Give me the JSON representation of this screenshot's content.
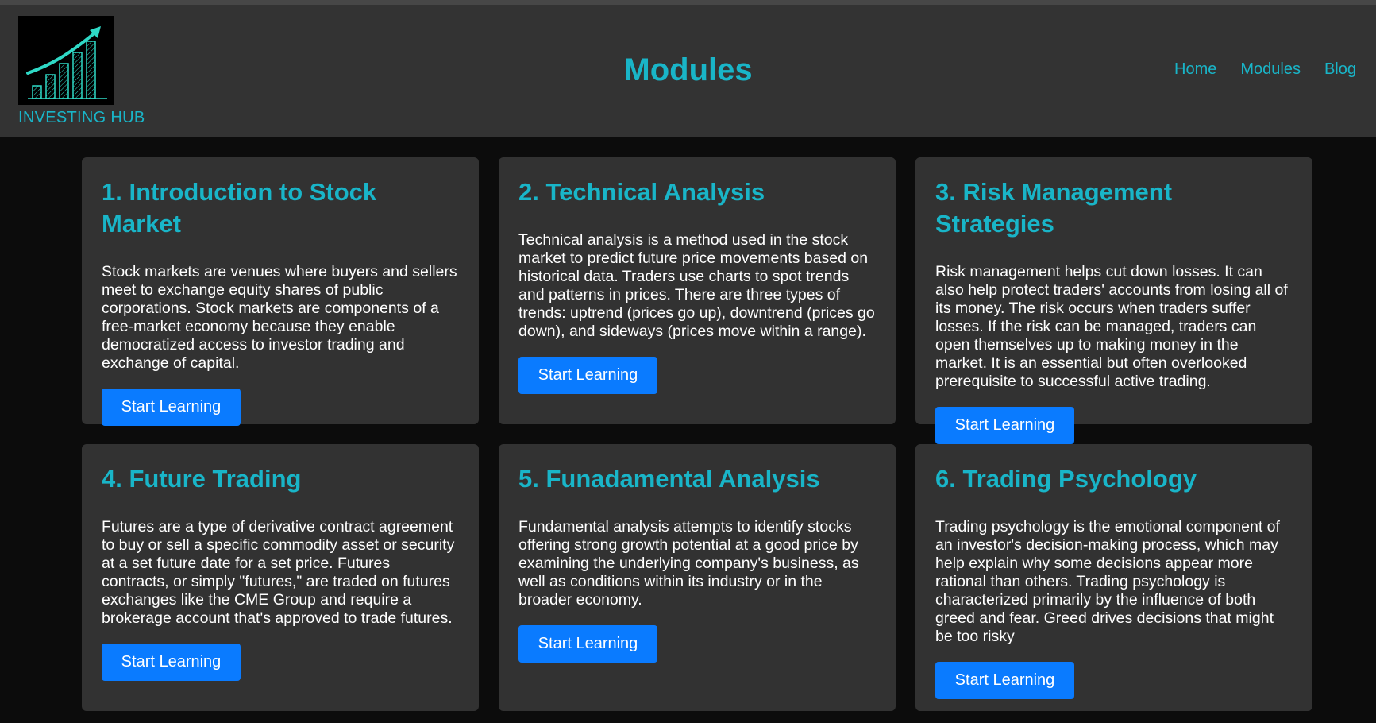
{
  "header": {
    "brand": "INVESTING HUB",
    "title": "Modules",
    "nav": [
      "Home",
      "Modules",
      "Blog"
    ],
    "logo_icon": "rising-bar-chart-arrow-icon",
    "accent_color": "#19b5c8"
  },
  "modules": [
    {
      "title": "1. Introduction to Stock Market",
      "description": "Stock markets are venues where buyers and sellers meet to exchange equity shares of public corporations. Stock markets are components of a free-market economy because they enable democratized access to investor trading and exchange of capital.",
      "button": "Start Learning"
    },
    {
      "title": "2. Technical Analysis",
      "description": "Technical analysis is a method used in the stock market to predict future price movements based on historical data. Traders use charts to spot trends and patterns in prices. There are three types of trends: uptrend (prices go up), downtrend (prices go down), and sideways (prices move within a range).",
      "button": "Start Learning"
    },
    {
      "title": "3. Risk Management Strategies",
      "description": "Risk management helps cut down losses. It can also help protect traders' accounts from losing all of its money. The risk occurs when traders suffer losses. If the risk can be managed, traders can open themselves up to making money in the market. It is an essential but often overlooked prerequisite to successful active trading.",
      "button": "Start Learning"
    },
    {
      "title": "4. Future Trading",
      "description": "Futures are a type of derivative contract agreement to buy or sell a specific commodity asset or security at a set future date for a set price. Futures contracts, or simply \"futures,\" are traded on futures exchanges like the CME Group and require a brokerage account that's approved to trade futures.",
      "button": "Start Learning"
    },
    {
      "title": "5. Funadamental Analysis",
      "description": "Fundamental analysis attempts to identify stocks offering strong growth potential at a good price by examining the underlying company's business, as well as conditions within its industry or in the broader economy.",
      "button": "Start Learning"
    },
    {
      "title": "6. Trading Psychology",
      "description": "Trading psychology is the emotional component of an investor's decision-making process, which may help explain why some decisions appear more rational than others. Trading psychology is characterized primarily by the influence of both greed and fear. Greed drives decisions that might be too risky",
      "button": "Start Learning"
    }
  ],
  "colors": {
    "button": "#0a7bff",
    "card_bg": "#323232",
    "header_bg": "#333333",
    "page_bg": "#0c0c0c"
  }
}
